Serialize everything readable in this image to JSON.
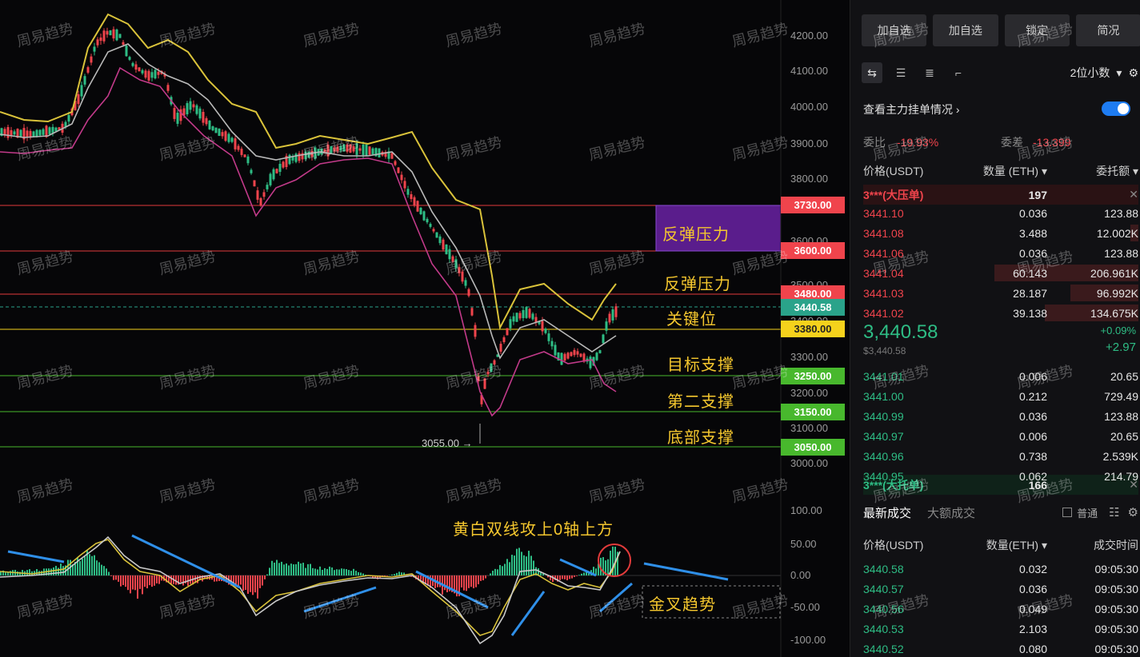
{
  "watermark": "周易趋势",
  "colors": {
    "up": "#2ebd85",
    "down": "#f0444c",
    "accent": "#1e7cf2",
    "label": "#f5c72e"
  },
  "y_axis": [
    "4200.00",
    "4100.00",
    "4000.00",
    "3900.00",
    "3800.00",
    "3700.00",
    "3600.00",
    "3500.00",
    "3400.00",
    "3300.00",
    "3200.00",
    "3100.00",
    "3000.00"
  ],
  "macd_axis": [
    "100.00",
    "50.00",
    "0.00",
    "-50.00",
    "-100.00"
  ],
  "price_tags": [
    {
      "value": "3730.00",
      "color": "#f0444c"
    },
    {
      "value": "3600.00",
      "color": "#f0444c"
    },
    {
      "value": "3480.00",
      "color": "#f0444c"
    },
    {
      "value": "3440.58",
      "color": "#2aa38a"
    },
    {
      "value": "3380.00",
      "color": "#f5d21c"
    },
    {
      "value": "3250.00",
      "color": "#48b82d"
    },
    {
      "value": "3150.00",
      "color": "#48b82d"
    },
    {
      "value": "3050.00",
      "color": "#48b82d"
    }
  ],
  "low_marker": "3055.00 →",
  "zones": {
    "rebound_1": "反弹压力",
    "rebound_2": "反弹压力",
    "key": "关键位",
    "target": "目标支撑",
    "second": "第二支撑",
    "bottom": "底部支撑"
  },
  "macd_note": "黄白双线攻上0轴上方",
  "golden_cross": "金叉趋势",
  "panel": {
    "buttons": [
      "加自选",
      "加自选",
      "锁定",
      "简况"
    ],
    "precision": "2位小数",
    "main_orders": "查看主力挂单情况 ›",
    "ratio_bid_label": "委比",
    "ratio_bid_value": "-19.93%",
    "ratio_diff_label": "委差",
    "ratio_diff_value": "-13.399",
    "col_price": "价格(USDT)",
    "col_qty": "数量 (ETH) ▾",
    "col_total": "委托额 ▾",
    "big_ask": {
      "label": "3***(大压单)",
      "qty": "197"
    },
    "asks": [
      {
        "price": "3441.10",
        "qty": "0.036",
        "total": "123.88"
      },
      {
        "price": "3441.08",
        "qty": "3.488",
        "total": "12.002K"
      },
      {
        "price": "3441.06",
        "qty": "0.036",
        "total": "123.88"
      },
      {
        "price": "3441.04",
        "qty": "60.143",
        "total": "206.961K"
      },
      {
        "price": "3441.03",
        "qty": "28.187",
        "total": "96.992K"
      },
      {
        "price": "3441.02",
        "qty": "39.138",
        "total": "134.675K"
      }
    ],
    "last_price": "3,440.58",
    "last_price_usd": "$3,440.58",
    "change_pct": "+0.09%",
    "change_abs": "+2.97",
    "bids": [
      {
        "price": "3441.01",
        "qty": "0.006",
        "total": "20.65"
      },
      {
        "price": "3441.00",
        "qty": "0.212",
        "total": "729.49"
      },
      {
        "price": "3440.99",
        "qty": "0.036",
        "total": "123.88"
      },
      {
        "price": "3440.97",
        "qty": "0.006",
        "total": "20.65"
      },
      {
        "price": "3440.96",
        "qty": "0.738",
        "total": "2.539K"
      },
      {
        "price": "3440.95",
        "qty": "0.062",
        "total": "214.79"
      }
    ],
    "big_bid": {
      "label": "3***(大托单)",
      "qty": "166"
    },
    "trade_tabs": [
      "最新成交",
      "大额成交"
    ],
    "normal_label": "普通",
    "trade_cols": [
      "价格(USDT)",
      "数量(ETH) ▾",
      "成交时间"
    ],
    "trades": [
      {
        "price": "3440.58",
        "qty": "0.032",
        "time": "09:05:30"
      },
      {
        "price": "3440.57",
        "qty": "0.036",
        "time": "09:05:30"
      },
      {
        "price": "3440.56",
        "qty": "0.049",
        "time": "09:05:30"
      },
      {
        "price": "3440.53",
        "qty": "2.103",
        "time": "09:05:30"
      },
      {
        "price": "3440.52",
        "qty": "0.080",
        "time": "09:05:30"
      }
    ]
  }
}
